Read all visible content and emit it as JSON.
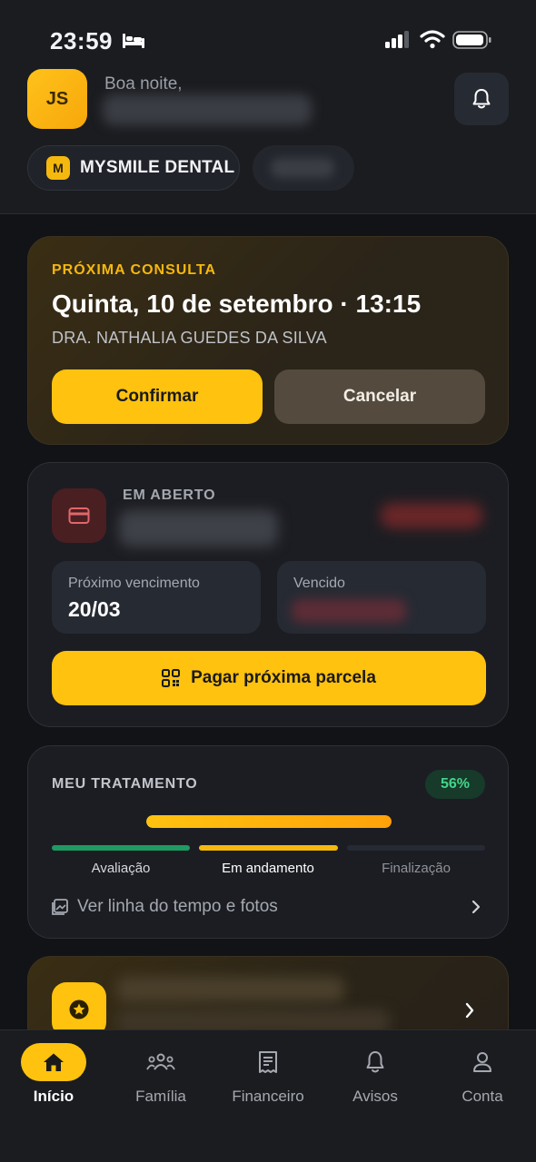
{
  "status_bar": {
    "time": "23:59",
    "icons": [
      "bed-icon",
      "signal-icon",
      "wifi-icon",
      "battery-icon"
    ]
  },
  "header": {
    "avatar_initials": "JS",
    "greeting": "Boa noite,",
    "bell_icon": "bell-icon",
    "clinic": {
      "badge": "M",
      "name": "MYSMILE DENTAL"
    }
  },
  "appointment": {
    "label": "PRÓXIMA CONSULTA",
    "date": "Quinta, 10 de setembro · 13:15",
    "doctor": "DRA. NATHALIA GUEDES DA SILVA",
    "confirm_label": "Confirmar",
    "cancel_label": "Cancelar"
  },
  "open_balance": {
    "label": "EM ABERTO",
    "icon": "credit-card-icon",
    "next_due_label": "Próximo vencimento",
    "next_due_value": "20/03",
    "overdue_label": "Vencido",
    "pay_label": "Pagar próxima parcela",
    "pay_icon": "qr-code-icon"
  },
  "treatment": {
    "label": "MEU TRATAMENTO",
    "percent_text": "56%",
    "progress": 1.0,
    "stages": [
      "Avaliação",
      "Em andamento",
      "Finalização"
    ],
    "timeline_link": "Ver linha do tempo e fotos"
  },
  "promo": {
    "icon": "star-icon"
  },
  "nav": {
    "items": [
      {
        "label": "Início",
        "icon": "home-icon",
        "active": true
      },
      {
        "label": "Família",
        "icon": "family-icon",
        "active": false
      },
      {
        "label": "Financeiro",
        "icon": "receipt-icon",
        "active": false
      },
      {
        "label": "Avisos",
        "icon": "bell-icon",
        "active": false
      },
      {
        "label": "Conta",
        "icon": "user-icon",
        "active": false
      }
    ]
  },
  "colors": {
    "accent": "#ffc20f",
    "background": "#121316",
    "card": "#1c1d22",
    "success": "#42d68a",
    "danger": "#e0676a"
  }
}
